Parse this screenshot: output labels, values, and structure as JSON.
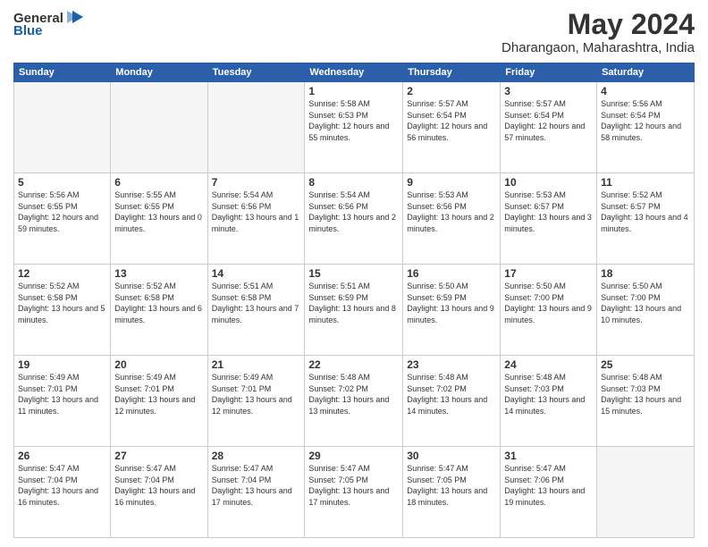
{
  "logo": {
    "general": "General",
    "blue": "Blue"
  },
  "title": {
    "month": "May 2024",
    "location": "Dharangaon, Maharashtra, India"
  },
  "headers": [
    "Sunday",
    "Monday",
    "Tuesday",
    "Wednesday",
    "Thursday",
    "Friday",
    "Saturday"
  ],
  "weeks": [
    [
      {
        "day": "",
        "empty": true
      },
      {
        "day": "",
        "empty": true
      },
      {
        "day": "",
        "empty": true
      },
      {
        "day": "1",
        "sunrise": "5:58 AM",
        "sunset": "6:53 PM",
        "daylight": "12 hours and 55 minutes."
      },
      {
        "day": "2",
        "sunrise": "5:57 AM",
        "sunset": "6:54 PM",
        "daylight": "12 hours and 56 minutes."
      },
      {
        "day": "3",
        "sunrise": "5:57 AM",
        "sunset": "6:54 PM",
        "daylight": "12 hours and 57 minutes."
      },
      {
        "day": "4",
        "sunrise": "5:56 AM",
        "sunset": "6:54 PM",
        "daylight": "12 hours and 58 minutes."
      }
    ],
    [
      {
        "day": "5",
        "sunrise": "5:56 AM",
        "sunset": "6:55 PM",
        "daylight": "12 hours and 59 minutes."
      },
      {
        "day": "6",
        "sunrise": "5:55 AM",
        "sunset": "6:55 PM",
        "daylight": "13 hours and 0 minutes."
      },
      {
        "day": "7",
        "sunrise": "5:54 AM",
        "sunset": "6:56 PM",
        "daylight": "13 hours and 1 minute."
      },
      {
        "day": "8",
        "sunrise": "5:54 AM",
        "sunset": "6:56 PM",
        "daylight": "13 hours and 2 minutes."
      },
      {
        "day": "9",
        "sunrise": "5:53 AM",
        "sunset": "6:56 PM",
        "daylight": "13 hours and 2 minutes."
      },
      {
        "day": "10",
        "sunrise": "5:53 AM",
        "sunset": "6:57 PM",
        "daylight": "13 hours and 3 minutes."
      },
      {
        "day": "11",
        "sunrise": "5:52 AM",
        "sunset": "6:57 PM",
        "daylight": "13 hours and 4 minutes."
      }
    ],
    [
      {
        "day": "12",
        "sunrise": "5:52 AM",
        "sunset": "6:58 PM",
        "daylight": "13 hours and 5 minutes."
      },
      {
        "day": "13",
        "sunrise": "5:52 AM",
        "sunset": "6:58 PM",
        "daylight": "13 hours and 6 minutes."
      },
      {
        "day": "14",
        "sunrise": "5:51 AM",
        "sunset": "6:58 PM",
        "daylight": "13 hours and 7 minutes."
      },
      {
        "day": "15",
        "sunrise": "5:51 AM",
        "sunset": "6:59 PM",
        "daylight": "13 hours and 8 minutes."
      },
      {
        "day": "16",
        "sunrise": "5:50 AM",
        "sunset": "6:59 PM",
        "daylight": "13 hours and 9 minutes."
      },
      {
        "day": "17",
        "sunrise": "5:50 AM",
        "sunset": "7:00 PM",
        "daylight": "13 hours and 9 minutes."
      },
      {
        "day": "18",
        "sunrise": "5:50 AM",
        "sunset": "7:00 PM",
        "daylight": "13 hours and 10 minutes."
      }
    ],
    [
      {
        "day": "19",
        "sunrise": "5:49 AM",
        "sunset": "7:01 PM",
        "daylight": "13 hours and 11 minutes."
      },
      {
        "day": "20",
        "sunrise": "5:49 AM",
        "sunset": "7:01 PM",
        "daylight": "13 hours and 12 minutes."
      },
      {
        "day": "21",
        "sunrise": "5:49 AM",
        "sunset": "7:01 PM",
        "daylight": "13 hours and 12 minutes."
      },
      {
        "day": "22",
        "sunrise": "5:48 AM",
        "sunset": "7:02 PM",
        "daylight": "13 hours and 13 minutes."
      },
      {
        "day": "23",
        "sunrise": "5:48 AM",
        "sunset": "7:02 PM",
        "daylight": "13 hours and 14 minutes."
      },
      {
        "day": "24",
        "sunrise": "5:48 AM",
        "sunset": "7:03 PM",
        "daylight": "13 hours and 14 minutes."
      },
      {
        "day": "25",
        "sunrise": "5:48 AM",
        "sunset": "7:03 PM",
        "daylight": "13 hours and 15 minutes."
      }
    ],
    [
      {
        "day": "26",
        "sunrise": "5:47 AM",
        "sunset": "7:04 PM",
        "daylight": "13 hours and 16 minutes."
      },
      {
        "day": "27",
        "sunrise": "5:47 AM",
        "sunset": "7:04 PM",
        "daylight": "13 hours and 16 minutes."
      },
      {
        "day": "28",
        "sunrise": "5:47 AM",
        "sunset": "7:04 PM",
        "daylight": "13 hours and 17 minutes."
      },
      {
        "day": "29",
        "sunrise": "5:47 AM",
        "sunset": "7:05 PM",
        "daylight": "13 hours and 17 minutes."
      },
      {
        "day": "30",
        "sunrise": "5:47 AM",
        "sunset": "7:05 PM",
        "daylight": "13 hours and 18 minutes."
      },
      {
        "day": "31",
        "sunrise": "5:47 AM",
        "sunset": "7:06 PM",
        "daylight": "13 hours and 19 minutes."
      },
      {
        "day": "",
        "empty": true
      }
    ]
  ]
}
